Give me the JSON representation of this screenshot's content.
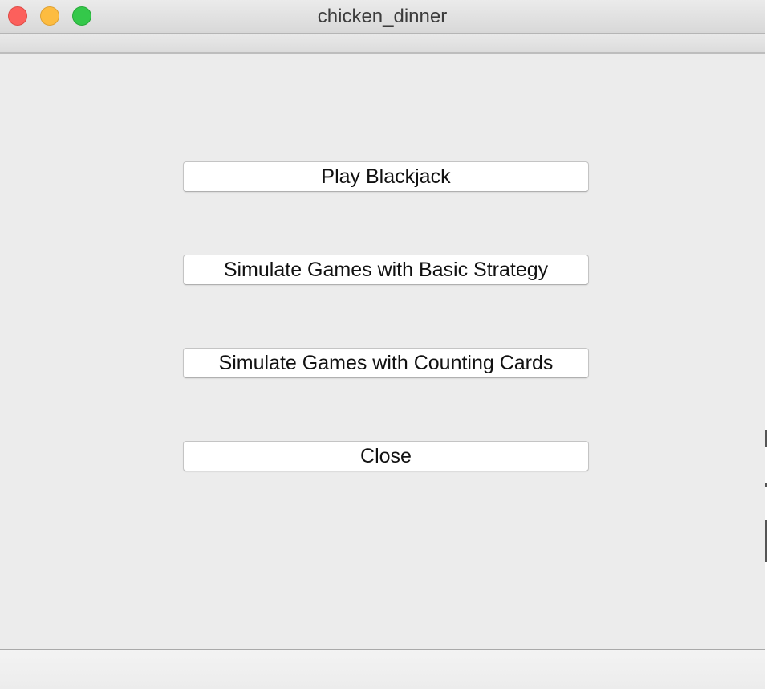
{
  "window": {
    "title": "chicken_dinner",
    "traffic_lights": {
      "close_color": "#fc605c",
      "minimize_color": "#fdbc40",
      "zoom_color": "#34c84a"
    }
  },
  "menu": {
    "buttons": [
      {
        "label": "Play Blackjack"
      },
      {
        "label": "Simulate Games with Basic Strategy"
      },
      {
        "label": "Simulate Games with Counting Cards"
      },
      {
        "label": "Close"
      }
    ]
  }
}
